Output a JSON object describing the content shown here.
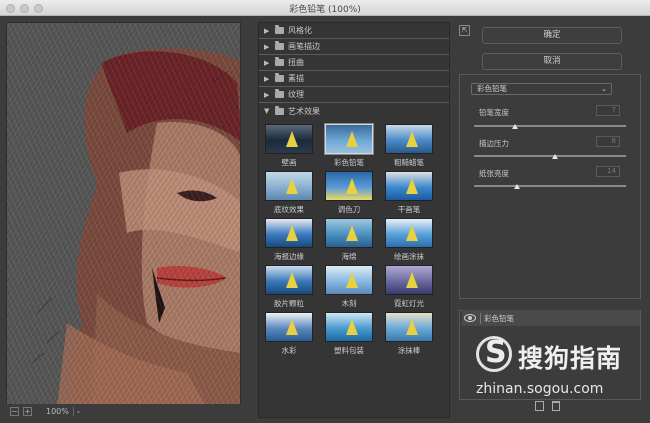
{
  "window": {
    "title": "彩色铅笔 (100%)"
  },
  "preview": {
    "zoom": "100%",
    "zoom_out": "−",
    "zoom_in": "+",
    "zoom_menu": "⌄"
  },
  "gallery": {
    "categories": [
      {
        "label": "风格化",
        "expanded": false
      },
      {
        "label": "画笔描边",
        "expanded": false
      },
      {
        "label": "扭曲",
        "expanded": false
      },
      {
        "label": "素描",
        "expanded": false
      },
      {
        "label": "纹理",
        "expanded": false
      },
      {
        "label": "艺术效果",
        "expanded": true
      }
    ],
    "filters": [
      "壁画",
      "彩色铅笔",
      "粗糙蜡笔",
      "底纹效果",
      "调色刀",
      "干画笔",
      "海报边缘",
      "海绵",
      "绘画涂抹",
      "胶片颗粒",
      "木刻",
      "霓虹灯光",
      "水彩",
      "塑料包装",
      "涂抹棒"
    ],
    "selected_filter": "彩色铅笔"
  },
  "actions": {
    "ok": "确定",
    "cancel": "取消",
    "collapse": "⇱"
  },
  "settings": {
    "filter_select": "彩色铅笔",
    "params": [
      {
        "label": "铅笔宽度",
        "value": "7",
        "fraction": 0.27
      },
      {
        "label": "描边压力",
        "value": "8",
        "fraction": 0.53
      },
      {
        "label": "纸张亮度",
        "value": "14",
        "fraction": 0.28
      }
    ]
  },
  "layers": {
    "items": [
      {
        "label": "彩色铅笔"
      }
    ]
  },
  "watermark": {
    "brand": "搜狗指南",
    "url": "zhinan.sogou.com"
  },
  "colors": {
    "bg": "#3c3c3c",
    "panel": "#353535",
    "accent_border": "#d8d8d8"
  }
}
